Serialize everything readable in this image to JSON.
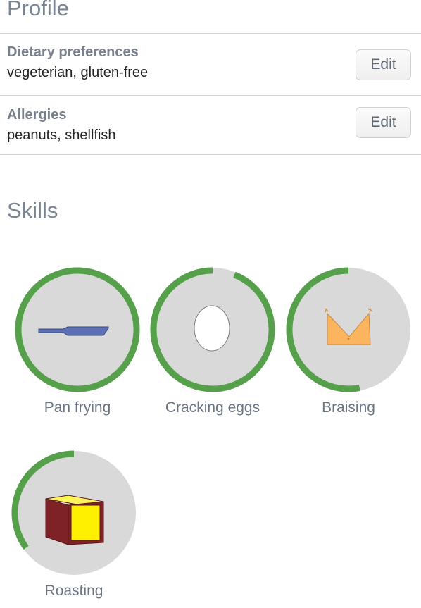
{
  "profile": {
    "title": "Profile",
    "preferences": [
      {
        "label": "Dietary preferences",
        "value": "vegeterian, gluten-free",
        "edit_label": "Edit"
      },
      {
        "label": "Allergies",
        "value": "peanuts, shellfish",
        "edit_label": "Edit"
      }
    ]
  },
  "skills": {
    "title": "Skills",
    "items": [
      {
        "name": "Pan frying",
        "icon": "frying-pan-icon",
        "progress": 1.0
      },
      {
        "name": "Cracking eggs",
        "icon": "egg-icon",
        "progress": 0.94
      },
      {
        "name": "Braising",
        "icon": "braising-pot-icon",
        "progress": 0.53
      },
      {
        "name": "Roasting",
        "icon": "roasting-box-icon",
        "progress": 0.35
      }
    ]
  },
  "colors": {
    "progress": "#56a04c",
    "track": "#d9d9d9",
    "pan": "#5b6fb5",
    "pot": "#fbb55e",
    "box_side": "#7f2225",
    "box_face": "#fff000"
  }
}
